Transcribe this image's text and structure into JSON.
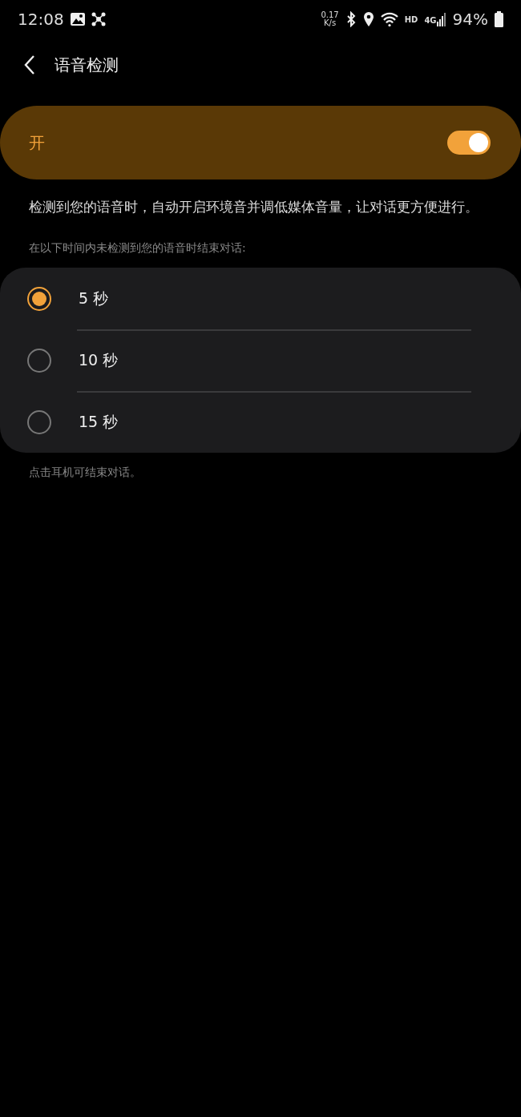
{
  "status_bar": {
    "time": "12:08",
    "speed_value": "0.17",
    "speed_unit": "K/s",
    "hd": "HD",
    "network": "4G",
    "battery": "94%"
  },
  "header": {
    "title": "语音检测"
  },
  "master_switch": {
    "label": "开",
    "on": true
  },
  "description": "检测到您的语音时，自动开启环境音并调低媒体音量，让对话更方便进行。",
  "section_label": "在以下时间内未检测到您的语音时结束对话:",
  "options": [
    {
      "label": "5 秒",
      "selected": true
    },
    {
      "label": "10 秒",
      "selected": false
    },
    {
      "label": "15 秒",
      "selected": false
    }
  ],
  "footer_note": "点击耳机可结束对话。"
}
